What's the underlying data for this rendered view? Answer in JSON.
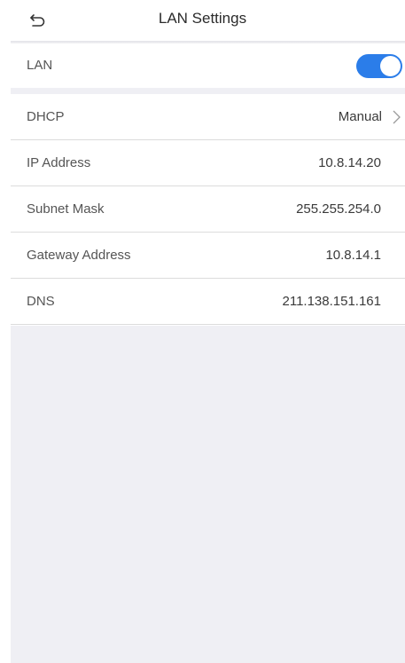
{
  "header": {
    "title": "LAN Settings",
    "back_icon": "back-arrow-icon"
  },
  "lan": {
    "label": "LAN",
    "enabled": true,
    "toggle_color": "#2b7de9"
  },
  "settings": [
    {
      "label": "DHCP",
      "value": "Manual",
      "has_chevron": true
    },
    {
      "label": "IP Address",
      "value": "10.8.14.20"
    },
    {
      "label": "Subnet Mask",
      "value": "255.255.254.0"
    },
    {
      "label": "Gateway Address",
      "value": "10.8.14.1"
    },
    {
      "label": "DNS",
      "value": "211.138.151.161"
    }
  ]
}
